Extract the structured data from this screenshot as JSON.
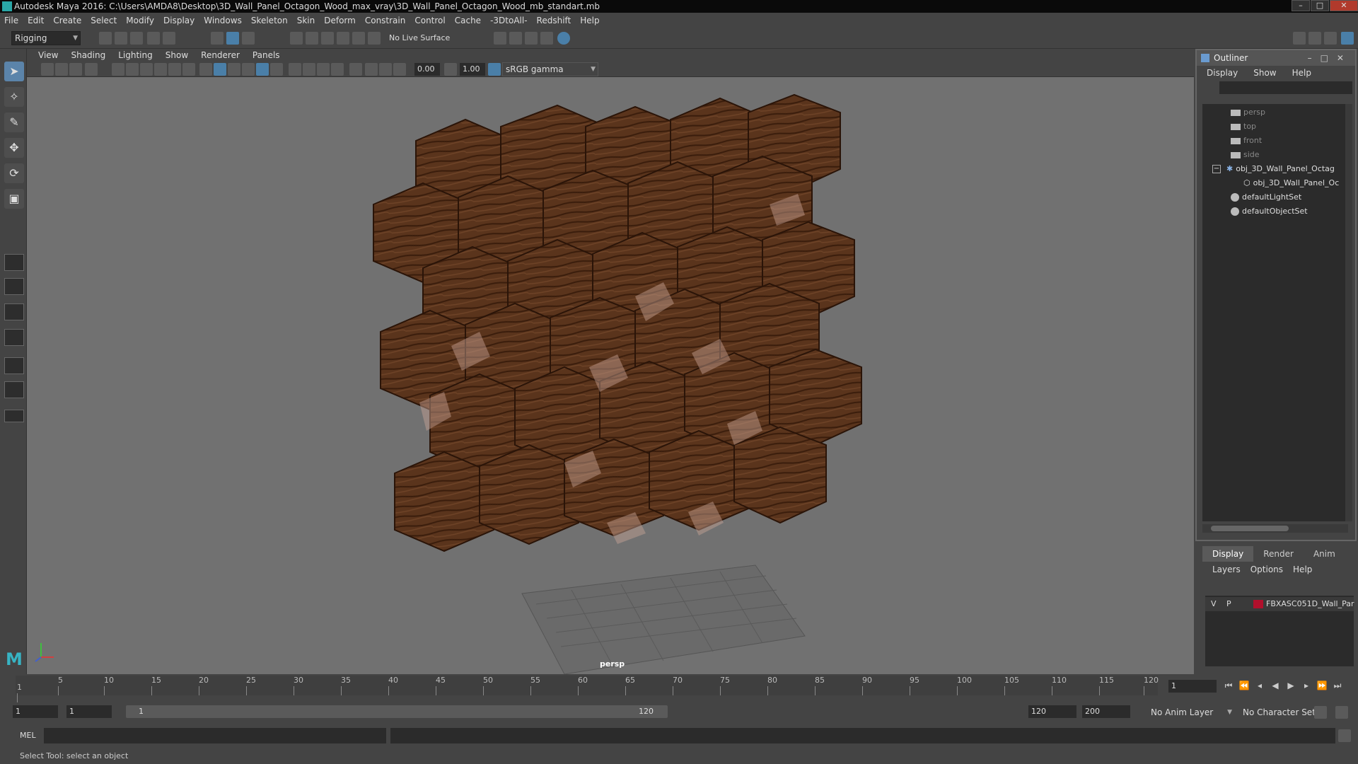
{
  "window": {
    "title": "Autodesk Maya 2016: C:\\Users\\AMDA8\\Desktop\\3D_Wall_Panel_Octagon_Wood_max_vray\\3D_Wall_Panel_Octagon_Wood_mb_standart.mb",
    "minimize": "–",
    "maximize": "□",
    "close": "✕"
  },
  "menubar": [
    "File",
    "Edit",
    "Create",
    "Select",
    "Modify",
    "Display",
    "Windows",
    "Skeleton",
    "Skin",
    "Deform",
    "Constrain",
    "Control",
    "Cache",
    "-3DtoAll-",
    "Redshift",
    "Help"
  ],
  "shelf": {
    "mode": "Rigging",
    "live_surface": "No Live Surface"
  },
  "panel_menu": [
    "View",
    "Shading",
    "Lighting",
    "Show",
    "Renderer",
    "Panels"
  ],
  "panel_tools": {
    "exposure": "0.00",
    "gamma": "1.00",
    "color_space": "sRGB gamma"
  },
  "viewport": {
    "camera_label": "persp",
    "background": "#717171",
    "wood_color": "#5a341c"
  },
  "outliner": {
    "title": "Outliner",
    "menu": [
      "Display",
      "Show",
      "Help"
    ],
    "items": [
      {
        "label": "persp",
        "icon": "camera-icon",
        "dim": true
      },
      {
        "label": "top",
        "icon": "camera-icon",
        "dim": true
      },
      {
        "label": "front",
        "icon": "camera-icon",
        "dim": true
      },
      {
        "label": "side",
        "icon": "camera-icon",
        "dim": true
      },
      {
        "label": "obj_3D_Wall_Panel_Octag",
        "icon": "transform-icon",
        "dim": false
      },
      {
        "label": "obj_3D_Wall_Panel_Oc",
        "icon": "mesh-icon",
        "dim": false
      },
      {
        "label": "defaultLightSet",
        "icon": "set-icon",
        "dim": false
      },
      {
        "label": "defaultObjectSet",
        "icon": "set-icon",
        "dim": false
      }
    ]
  },
  "layers": {
    "tabs": [
      "Display",
      "Render",
      "Anim"
    ],
    "menu": [
      "Layers",
      "Options",
      "Help"
    ],
    "row": {
      "v": "V",
      "p": "P",
      "name": "FBXASC051D_Wall_Par",
      "color": "#b0102c"
    }
  },
  "timeline": {
    "ticks": [
      "5",
      "10",
      "15",
      "20",
      "25",
      "30",
      "35",
      "40",
      "45",
      "50",
      "55",
      "60",
      "65",
      "70",
      "75",
      "80",
      "85",
      "90",
      "95",
      "100",
      "105",
      "110",
      "115",
      "120"
    ],
    "first_frame": "1",
    "current_frame": "1"
  },
  "range": {
    "start": "1",
    "playback_start": "1",
    "slider_start": "1",
    "slider_end": "120",
    "playback_end": "120",
    "end": "200",
    "anim_layer": "No Anim Layer",
    "character_set": "No Character Set"
  },
  "command": {
    "label": "MEL"
  },
  "status": {
    "message": "Select Tool: select an object"
  }
}
